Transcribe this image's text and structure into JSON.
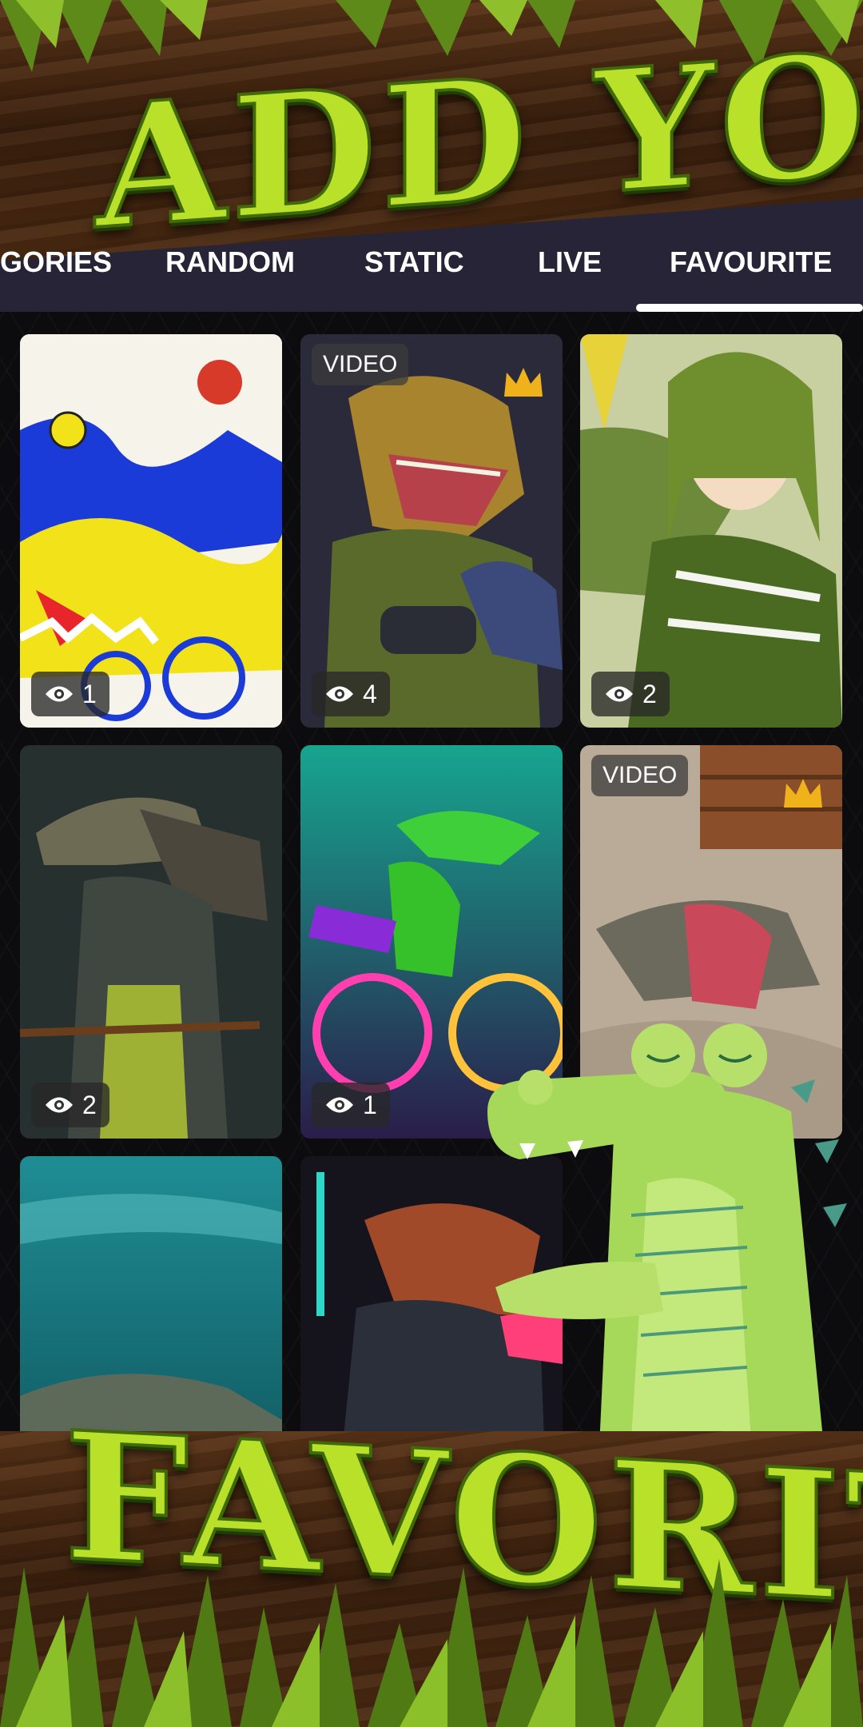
{
  "promo": {
    "headline_top": "ADD YOUR",
    "headline_bottom": "FAVORITES"
  },
  "tabs": [
    {
      "label": "GORIES",
      "active": false
    },
    {
      "label": "RANDOM",
      "active": false
    },
    {
      "label": "STATIC",
      "active": false
    },
    {
      "label": "LIVE",
      "active": false
    },
    {
      "label": "FAVOURITE",
      "active": true
    }
  ],
  "colors": {
    "tab_bar": "#262436",
    "headline": "#b9e12a",
    "crown": "#f0b21a",
    "mascot": "#a6d85a"
  },
  "wallpapers": [
    {
      "type": "static",
      "views": "1",
      "premium": false,
      "theme": "yellow-blue crocodile cyclist illustration"
    },
    {
      "type": "video",
      "label": "VIDEO",
      "views": "4",
      "premium": true,
      "theme": "armored gamer crocodile"
    },
    {
      "type": "static",
      "views": "2",
      "premium": false,
      "theme": "anime girl with crocodile"
    },
    {
      "type": "static",
      "views": "2",
      "premium": false,
      "theme": "samurai crocodile"
    },
    {
      "type": "static",
      "views": "1",
      "premium": false,
      "theme": "neon crocodile on bicycle"
    },
    {
      "type": "video",
      "label": "VIDEO",
      "premium": true,
      "theme": "open-mouthed alligator"
    },
    {
      "type": "static",
      "theme": "crocodile underwater"
    },
    {
      "type": "static",
      "theme": "neon cyberpunk crocodile"
    }
  ],
  "icons": {
    "views": "eye-icon",
    "premium": "crown-icon"
  }
}
